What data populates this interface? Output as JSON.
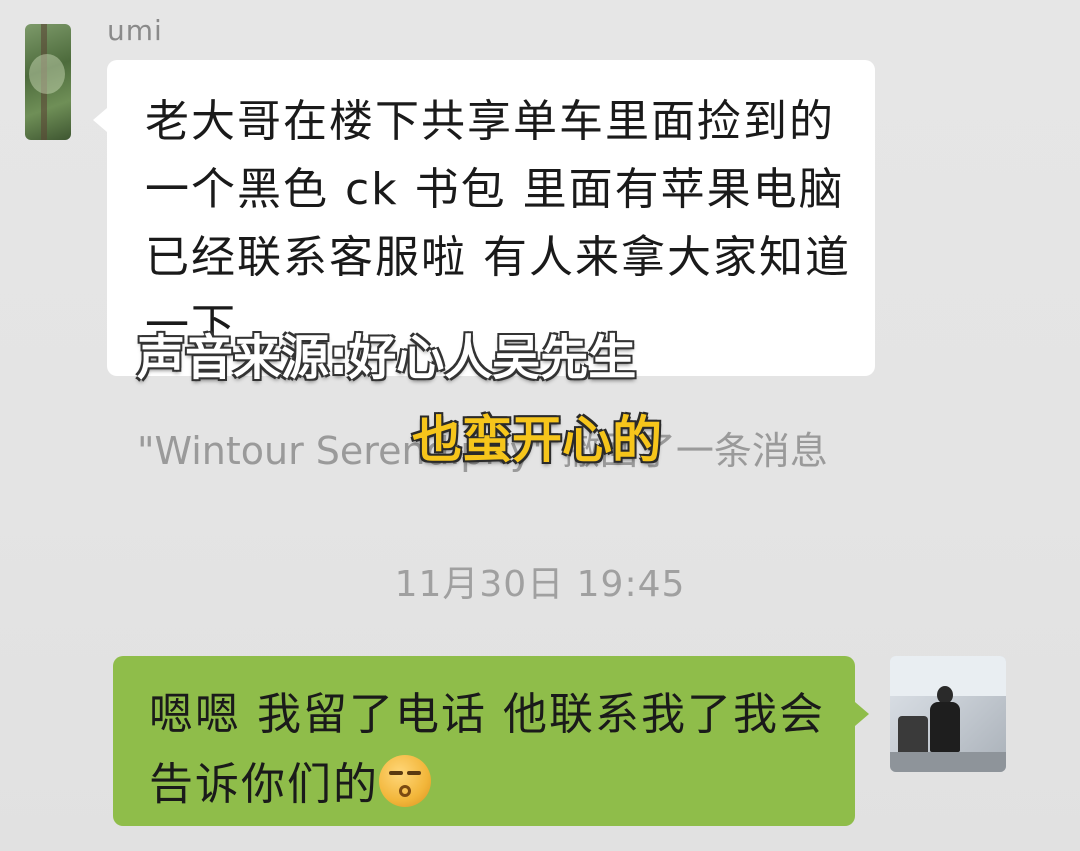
{
  "incoming": {
    "sender_name": "umi",
    "message": "老大哥在楼下共享单车里面捡到的一个黑色 ck 书包 里面有苹果电脑 已经联系客服啦 有人来拿大家知道一下"
  },
  "system_note": "\"Wintour Serendipity\" 撤回了一条消息",
  "timestamp": "11月30日 19:45",
  "outgoing": {
    "message": "嗯嗯 我留了电话 他联系我了我会告诉你们的",
    "emoji": "smirk-emoji"
  },
  "captions": {
    "source": "声音来源:好心人吴先生",
    "subtitle": "也蛮开心的"
  },
  "colors": {
    "incoming_bubble": "#ffffff",
    "outgoing_bubble": "#8fbd4a",
    "caption_yellow": "#f6c51b"
  }
}
